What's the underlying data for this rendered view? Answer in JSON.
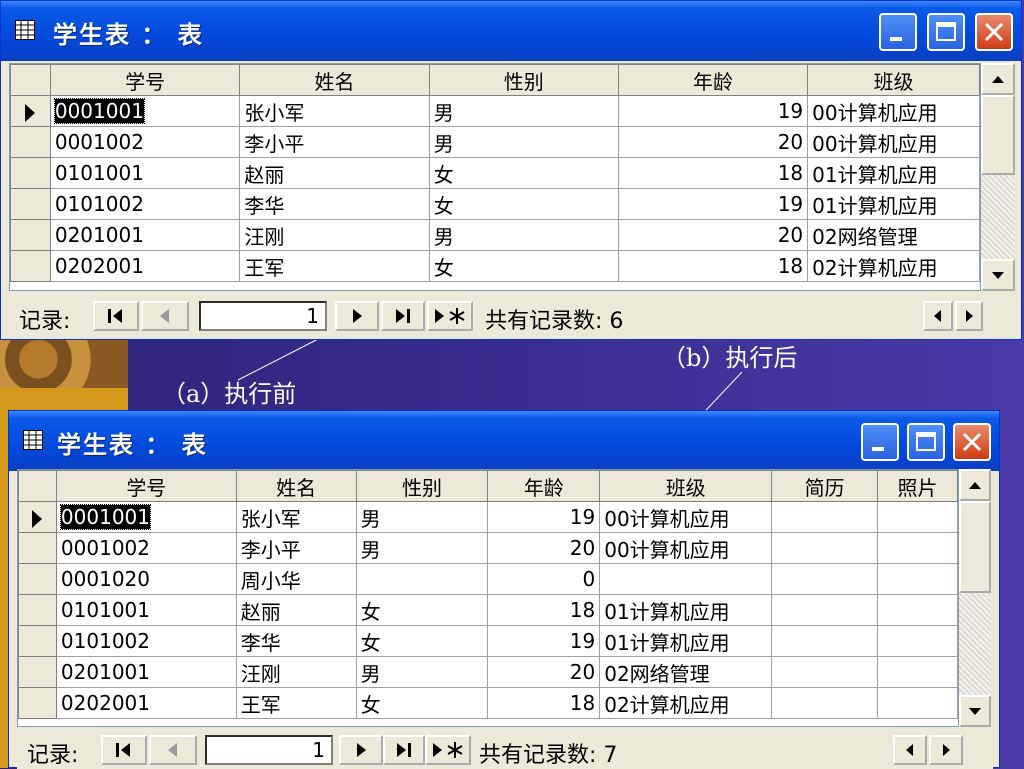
{
  "colors": {
    "accent": "#0349dc",
    "background": "#3a2f92",
    "close": "#cf3c14"
  },
  "captions": {
    "before": "（a）执行前",
    "after": "（b）执行后"
  },
  "before": {
    "title": "学生表 ： 表",
    "columns": [
      "学号",
      "姓名",
      "性别",
      "年龄",
      "班级"
    ],
    "rows": [
      [
        "0001001",
        "张小军",
        "男",
        "19",
        "00计算机应用"
      ],
      [
        "0001002",
        "李小平",
        "男",
        "20",
        "00计算机应用"
      ],
      [
        "0101001",
        "赵丽",
        "女",
        "18",
        "01计算机应用"
      ],
      [
        "0101002",
        "李华",
        "女",
        "19",
        "01计算机应用"
      ],
      [
        "0201001",
        "汪刚",
        "男",
        "20",
        "02网络管理"
      ],
      [
        "0202001",
        "王军",
        "女",
        "18",
        "02计算机应用"
      ]
    ],
    "nav": {
      "label": "记录:",
      "current": "1",
      "total": "共有记录数: 6"
    }
  },
  "after": {
    "title": "学生表 ： 表",
    "columns": [
      "学号",
      "姓名",
      "性别",
      "年龄",
      "班级",
      "简历",
      "照片"
    ],
    "rows": [
      [
        "0001001",
        "张小军",
        "男",
        "19",
        "00计算机应用",
        "",
        ""
      ],
      [
        "0001002",
        "李小平",
        "男",
        "20",
        "00计算机应用",
        "",
        ""
      ],
      [
        "0001020",
        "周小华",
        "",
        "0",
        "",
        "",
        ""
      ],
      [
        "0101001",
        "赵丽",
        "女",
        "18",
        "01计算机应用",
        "",
        ""
      ],
      [
        "0101002",
        "李华",
        "女",
        "19",
        "01计算机应用",
        "",
        ""
      ],
      [
        "0201001",
        "汪刚",
        "男",
        "20",
        "02网络管理",
        "",
        ""
      ],
      [
        "0202001",
        "王军",
        "女",
        "18",
        "02计算机应用",
        "",
        ""
      ]
    ],
    "nav": {
      "label": "记录:",
      "current": "1",
      "total": "共有记录数: 7"
    }
  },
  "icons": [
    "table-icon",
    "minimize-icon",
    "maximize-icon",
    "close-icon",
    "first-record-icon",
    "prev-record-icon",
    "next-record-icon",
    "last-record-icon",
    "new-record-icon",
    "record-selector-arrow-icon",
    "scroll-up-icon",
    "scroll-down-icon",
    "scroll-left-icon",
    "scroll-right-icon"
  ]
}
